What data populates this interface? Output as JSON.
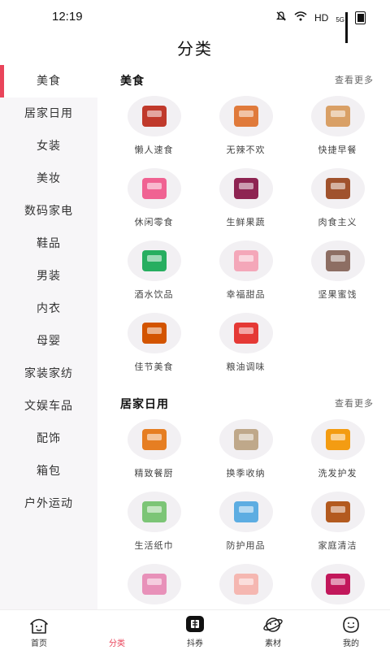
{
  "status_bar": {
    "time": "12:19",
    "network": "HD",
    "signal": "5G"
  },
  "header": {
    "title": "分类"
  },
  "sidebar": {
    "items": [
      {
        "label": "美食",
        "active": true
      },
      {
        "label": "居家日用"
      },
      {
        "label": "女装"
      },
      {
        "label": "美妆"
      },
      {
        "label": "数码家电"
      },
      {
        "label": "鞋品"
      },
      {
        "label": "男装"
      },
      {
        "label": "内衣"
      },
      {
        "label": "母婴"
      },
      {
        "label": "家装家纺"
      },
      {
        "label": "文娱车品"
      },
      {
        "label": "配饰"
      },
      {
        "label": "箱包"
      },
      {
        "label": "户外运动"
      }
    ]
  },
  "sections": [
    {
      "title": "美食",
      "more": "查看更多",
      "items": [
        {
          "label": "懒人速食",
          "icon": "instant-noodles-icon",
          "color": "#c0392b"
        },
        {
          "label": "无辣不欢",
          "icon": "spicy-snack-icon",
          "color": "#e07a3b"
        },
        {
          "label": "快捷早餐",
          "icon": "bread-milk-icon",
          "color": "#d9a066"
        },
        {
          "label": "休闲零食",
          "icon": "snack-bag-icon",
          "color": "#f06292"
        },
        {
          "label": "生鲜果蔬",
          "icon": "fruits-icon",
          "color": "#8e2452"
        },
        {
          "label": "肉食主义",
          "icon": "meat-icon",
          "color": "#a0522d"
        },
        {
          "label": "酒水饮品",
          "icon": "drinks-icon",
          "color": "#27ae60"
        },
        {
          "label": "幸福甜品",
          "icon": "macaron-icon",
          "color": "#f4a7b9"
        },
        {
          "label": "坚果蜜饯",
          "icon": "nuts-box-icon",
          "color": "#8d6e63"
        },
        {
          "label": "佳节美食",
          "icon": "zongzi-icon",
          "color": "#d35400"
        },
        {
          "label": "粮油调味",
          "icon": "rice-oil-icon",
          "color": "#e53935"
        }
      ]
    },
    {
      "title": "居家日用",
      "more": "查看更多",
      "items": [
        {
          "label": "精致餐厨",
          "icon": "pot-icon",
          "color": "#e67e22"
        },
        {
          "label": "换季收纳",
          "icon": "storage-drawer-icon",
          "color": "#bfa88a"
        },
        {
          "label": "洗发护发",
          "icon": "shampoo-icon",
          "color": "#f39c12"
        },
        {
          "label": "生活纸巾",
          "icon": "tissue-icon",
          "color": "#7cc576"
        },
        {
          "label": "防护用品",
          "icon": "mask-icon",
          "color": "#5dade2"
        },
        {
          "label": "家庭清洁",
          "icon": "disinfectant-icon",
          "color": "#b35a1f"
        },
        {
          "label": "",
          "icon": "sanitary-pad-icon",
          "color": "#e891b9"
        },
        {
          "label": "",
          "icon": "kids-cup-icon",
          "color": "#f5b7b1"
        },
        {
          "label": "",
          "icon": "perfume-icon",
          "color": "#c2185b"
        }
      ]
    }
  ],
  "bottom_nav": [
    {
      "label": "首页",
      "icon": "home-icon"
    },
    {
      "label": "分类",
      "icon": "category-icon",
      "active": true
    },
    {
      "label": "抖券",
      "icon": "coupon-icon"
    },
    {
      "label": "素材",
      "icon": "planet-icon"
    },
    {
      "label": "我的",
      "icon": "smiley-icon"
    }
  ],
  "colors": {
    "accent": "#e9445a",
    "sidebar_bg": "#f7f6f8",
    "thumb_bg": "#f2f0f3"
  }
}
